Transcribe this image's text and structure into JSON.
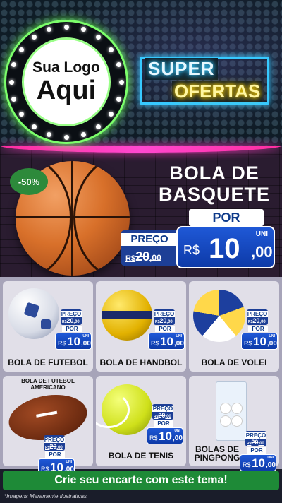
{
  "logo": {
    "line1": "Sua Logo",
    "line2": "Aqui"
  },
  "neon": {
    "super": "SUPER",
    "ofertas": "OFERTAS"
  },
  "hero": {
    "discount": "-50%",
    "title_line1": "BOLA DE",
    "title_line2": "BASQUETE",
    "por": "POR",
    "preco_label": "PREÇO",
    "old_price_prefix": "R$",
    "old_price_int": "20",
    "old_price_cents": ",00",
    "currency": "R$",
    "price_int": "10",
    "price_cents": ",00",
    "unit": "UNI"
  },
  "products": [
    {
      "name": "BOLA DE FUTEBOL",
      "preco_label": "PREÇO",
      "old_prefix": "R$",
      "old_int": "20",
      "old_cents": ",00",
      "por": "POR",
      "currency": "R$",
      "price_int": "10",
      "price_cents": ",00",
      "unit": "UNI"
    },
    {
      "name": "BOLA DE HANDBOL",
      "preco_label": "PREÇO",
      "old_prefix": "R$",
      "old_int": "20",
      "old_cents": ",00",
      "por": "POR",
      "currency": "R$",
      "price_int": "10",
      "price_cents": ",00",
      "unit": "UNI"
    },
    {
      "name": "BOLA DE VOLEI",
      "preco_label": "PREÇO",
      "old_prefix": "R$",
      "old_int": "20",
      "old_cents": ",00",
      "por": "POR",
      "currency": "R$",
      "price_int": "10",
      "price_cents": ",00",
      "unit": "UNI"
    },
    {
      "name_line1": "BOLA DE FUTEBOL",
      "name_line2": "AMERICANO",
      "preco_label": "PREÇO",
      "old_prefix": "R$",
      "old_int": "20",
      "old_cents": ",00",
      "por": "POR",
      "currency": "R$",
      "price_int": "10",
      "price_cents": ",00",
      "unit": "UNI"
    },
    {
      "name": "BOLA DE TENIS",
      "preco_label": "PREÇO",
      "old_prefix": "R$",
      "old_int": "20",
      "old_cents": ",00",
      "por": "POR",
      "currency": "R$",
      "price_int": "10",
      "price_cents": ",00",
      "unit": "UNI"
    },
    {
      "name_line1": "BOLAS DE",
      "name_line2": "PINGPONG",
      "preco_label": "PREÇO",
      "old_prefix": "R$",
      "old_int": "20",
      "old_cents": ",00",
      "por": "POR",
      "currency": "R$",
      "price_int": "10",
      "price_cents": ",00",
      "unit": "UNI"
    }
  ],
  "cta": {
    "label": "Crie seu encarte com este tema!"
  },
  "footnote": "*Imagens Meramente Ilustrativas",
  "colors": {
    "accent_blue": "#1f58d6",
    "green": "#1e8a37",
    "neon_pink": "#ff3dc4",
    "neon_cyan": "#37c9ff",
    "neon_yellow": "#ffd700"
  }
}
